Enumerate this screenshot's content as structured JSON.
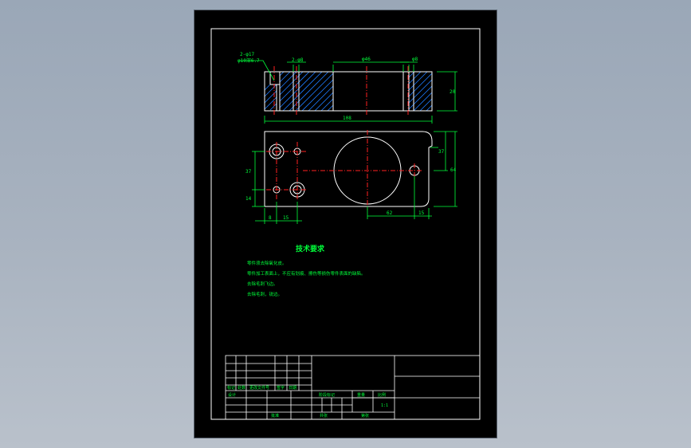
{
  "colors": {
    "background": "#a3aebb",
    "sheet": "#000000",
    "outline": "#ffffff",
    "dimension": "#00ff3a",
    "centerline": "#ff2020",
    "hatch": "#1e7bff"
  },
  "front_view": {
    "leader_top": "2-φ17",
    "leader_bottom": "φ10深6.7",
    "dim_pin": "2-φ8",
    "dim_bore": "φ46",
    "dim_small": "φ8",
    "dim_length": "108",
    "dim_height": "20"
  },
  "top_view": {
    "dim_vertical_a": "37",
    "dim_vertical_b": "14",
    "dim_x1": "8",
    "dim_x2": "15",
    "dim_x3": "62",
    "dim_x4": "15",
    "dim_right_a": "37",
    "dim_right_b": "64"
  },
  "tech_req": {
    "title": "技术要求",
    "lines": [
      "零件须去除氧化皮。",
      "零件加工表面上，不应有划痕、擦伤等损伤零件表面的缺陷。",
      "去除毛刺飞边。",
      "去除毛刺，锐边。"
    ]
  },
  "title_block": {
    "mark": "标记",
    "count": "处数",
    "file_no": "更改文件号",
    "signature": "签字",
    "date": "日期",
    "designer": "设计",
    "stage_mark": "阶段标记",
    "weight": "重量",
    "scale": "比例",
    "scale_value": "1:1",
    "approve": "批准",
    "sheets_total": "共张",
    "sheet_no": "第张"
  }
}
